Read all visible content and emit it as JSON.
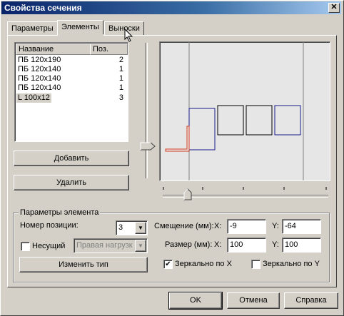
{
  "window": {
    "title": "Свойства сечения",
    "close_glyph": "✕"
  },
  "tabs": [
    {
      "label": "Параметры"
    },
    {
      "label": "Элементы"
    },
    {
      "label": "Выноски"
    }
  ],
  "list": {
    "headers": {
      "name": "Название",
      "pos": "Поз."
    },
    "rows": [
      {
        "name": "ПБ 120х190",
        "pos": "2"
      },
      {
        "name": "ПБ 120х140",
        "pos": "1"
      },
      {
        "name": "ПБ 120х140",
        "pos": "1"
      },
      {
        "name": "ПБ 120х140",
        "pos": "1"
      },
      {
        "name": "L 100x12",
        "pos": "3"
      }
    ]
  },
  "buttons": {
    "add": "Добавить",
    "delete": "Удалить",
    "change_type": "Изменить тип",
    "ok": "OK",
    "cancel": "Отмена",
    "help": "Справка"
  },
  "element_params": {
    "group_label": "Параметры элемента",
    "position_label": "Номер позиции:",
    "position_value": "3",
    "bearing_label": "Несущий",
    "bearing_checked": false,
    "load_value": "Правая нагрузк",
    "offset_label": "Смещение (мм):",
    "offset_x_label": "X:",
    "offset_x": "-9",
    "offset_y_label": "Y:",
    "offset_y": "-64",
    "size_label": "Размер (мм):",
    "size_x_label": "X:",
    "size_x": "100",
    "size_y_label": "Y:",
    "size_y": "100",
    "mirror_x_label": "Зеркально по X",
    "mirror_x_checked": true,
    "mirror_y_label": "Зеркально по Y",
    "mirror_y_checked": false
  },
  "colors": {
    "selected_outline": "#1a1a8c",
    "angle": "#d23c1e",
    "preview_bg": "#e6e6e6"
  }
}
